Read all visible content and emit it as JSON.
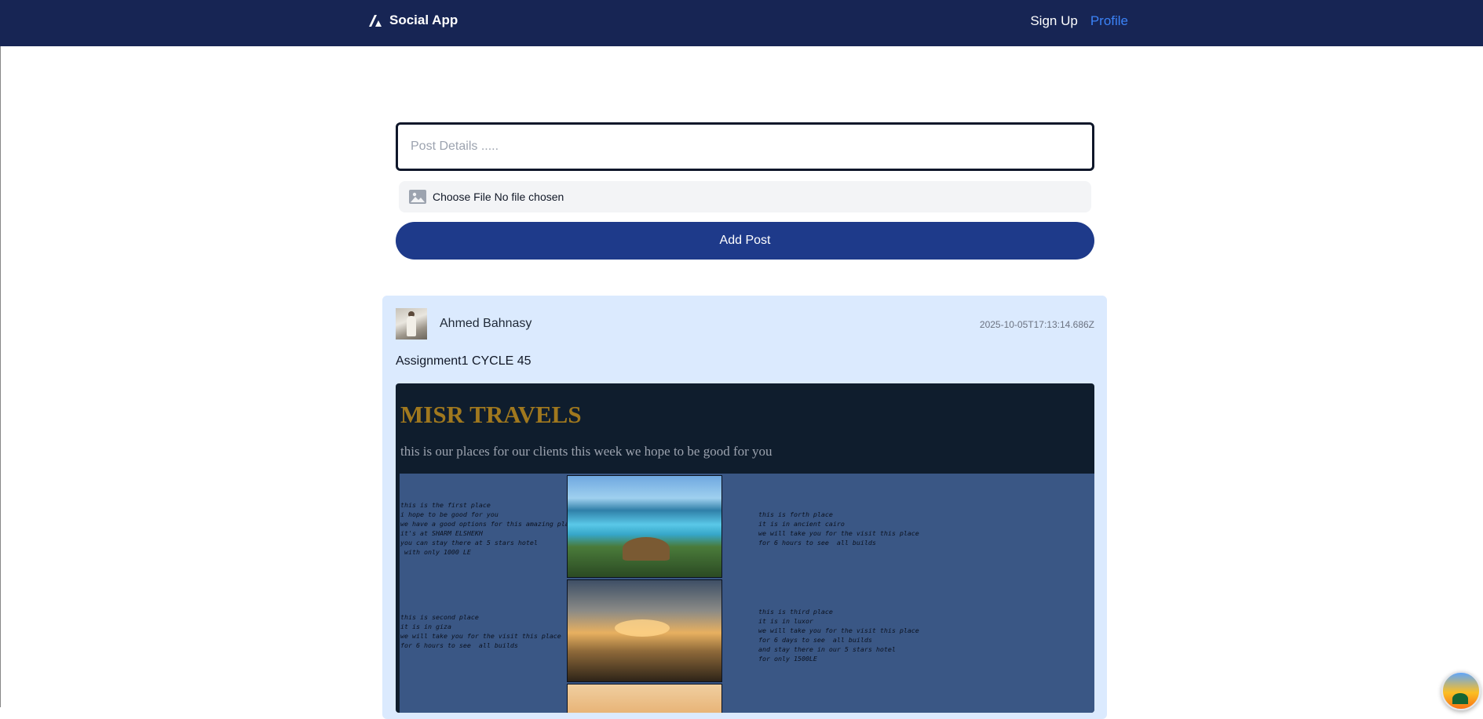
{
  "navbar": {
    "brand": "Social App",
    "links": {
      "signup": "Sign Up",
      "profile": "Profile"
    }
  },
  "form": {
    "post_placeholder": "Post Details .....",
    "file_label": "Choose File No file chosen",
    "submit_label": "Add Post"
  },
  "post": {
    "author": "Ahmed Bahnasy",
    "timestamp": "2025-10-05T17:13:14.686Z",
    "body": "Assignment1 CYCLE 45",
    "image": {
      "title": "MISR TRAVELS",
      "subtitle": "this is our places for our clients this week we hope to be good for you",
      "places": {
        "first": "this is the first place\ni hope to be good for you\nwe have a good options for this amazing places\nit's at SHARM ELSHEKH\nyou can stay there at 5 stars hotel\n with only 1000 LE",
        "forth": "this is forth place\nit is in ancient cairo\nwe will take you for the visit this place\nfor 6 hours to see  all builds",
        "second": "this is second place\nit is in giza\nwe will take you for the visit this place\nfor 6 hours to see  all builds",
        "third": "this is third place\nit is in luxor\nwe will take you for the visit this place\nfor 6 days to see  all builds\nand stay there in our 5 stars hotel\nfor only 1500LE"
      }
    }
  },
  "colors": {
    "navbar_bg": "#172554",
    "accent": "#3b82f6",
    "button_bg": "#1e3a8a",
    "card_bg": "#dbeafe",
    "image_title": "#a0781e"
  },
  "icons": {
    "brand": "triangle-logo-icon",
    "file": "image-icon"
  }
}
